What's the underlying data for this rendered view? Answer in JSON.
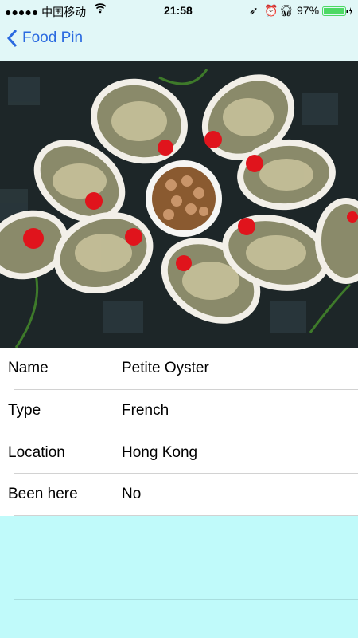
{
  "status_bar": {
    "carrier": "●●●●● 中国移动",
    "time": "21:58",
    "battery": "97%",
    "battery_level": 0.97,
    "battery_color": "#4cd964"
  },
  "nav": {
    "back_label": "Food Pin",
    "tint": "#2a6ae0"
  },
  "hero": {
    "subject": "oysters"
  },
  "details": [
    {
      "label": "Name",
      "value": "Petite Oyster"
    },
    {
      "label": "Type",
      "value": "French"
    },
    {
      "label": "Location",
      "value": "Hong Kong"
    },
    {
      "label": "Been here",
      "value": "No"
    }
  ]
}
